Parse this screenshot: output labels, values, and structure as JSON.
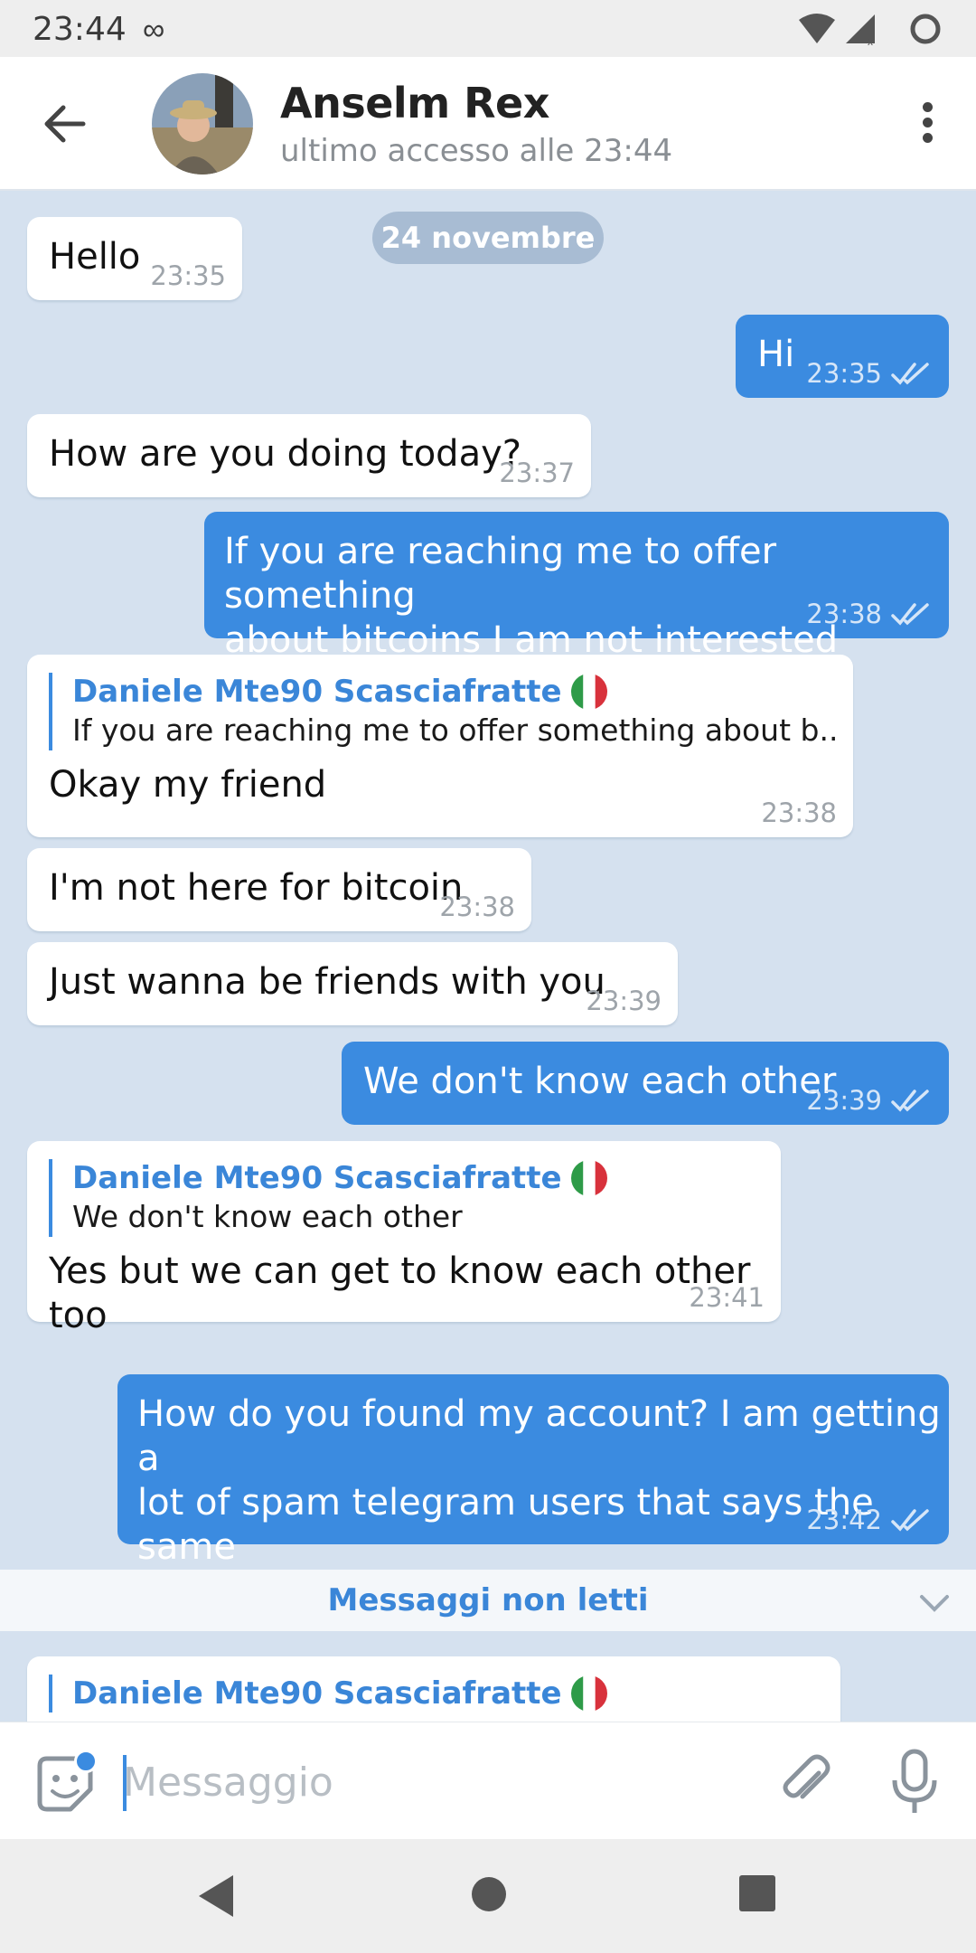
{
  "status_bar": {
    "time": "23:44",
    "notification_icon": "infinity-icon"
  },
  "header": {
    "contact_name": "Anselm Rex",
    "last_seen": "ultimo accesso alle 23:44"
  },
  "chat": {
    "date_separator": "24 novembre",
    "messages": [
      {
        "dir": "in",
        "text": "Hello",
        "time": "23:35"
      },
      {
        "dir": "out",
        "text": "Hi",
        "time": "23:35"
      },
      {
        "dir": "in",
        "text": "How are you doing today?",
        "time": "23:37"
      },
      {
        "dir": "out",
        "text": "If you are reaching me to offer something\nabout bitcoins I am not interested",
        "time": "23:38"
      },
      {
        "dir": "in",
        "reply_name": "Daniele Mte90 Scasciafratte",
        "reply_text": "If you are reaching me to offer something about b...",
        "text": "Okay my friend",
        "time": "23:38"
      },
      {
        "dir": "in",
        "text": "I'm not here for bitcoin",
        "time": "23:38"
      },
      {
        "dir": "in",
        "text": "Just wanna be friends with you",
        "time": "23:39"
      },
      {
        "dir": "out",
        "text": "We don't know each other",
        "time": "23:39"
      },
      {
        "dir": "in",
        "reply_name": "Daniele Mte90 Scasciafratte",
        "reply_text": "We don't know each other",
        "text": "Yes but we can get to know each other too",
        "time": "23:41"
      },
      {
        "dir": "out",
        "text": "How do you found my account? I am getting a\nlot of spam telegram users that says the same\nthings from people I don't know",
        "time": "23:42"
      },
      {
        "dir": "in",
        "reply_name": "Daniele Mte90 Scasciafratte"
      }
    ],
    "unread_label": "Messaggi non letti"
  },
  "input": {
    "placeholder": "Messaggio"
  },
  "colors": {
    "accent": "#3b8be0",
    "background": "#d5e1ef",
    "outgoing_bubble": "#3b8be0"
  }
}
